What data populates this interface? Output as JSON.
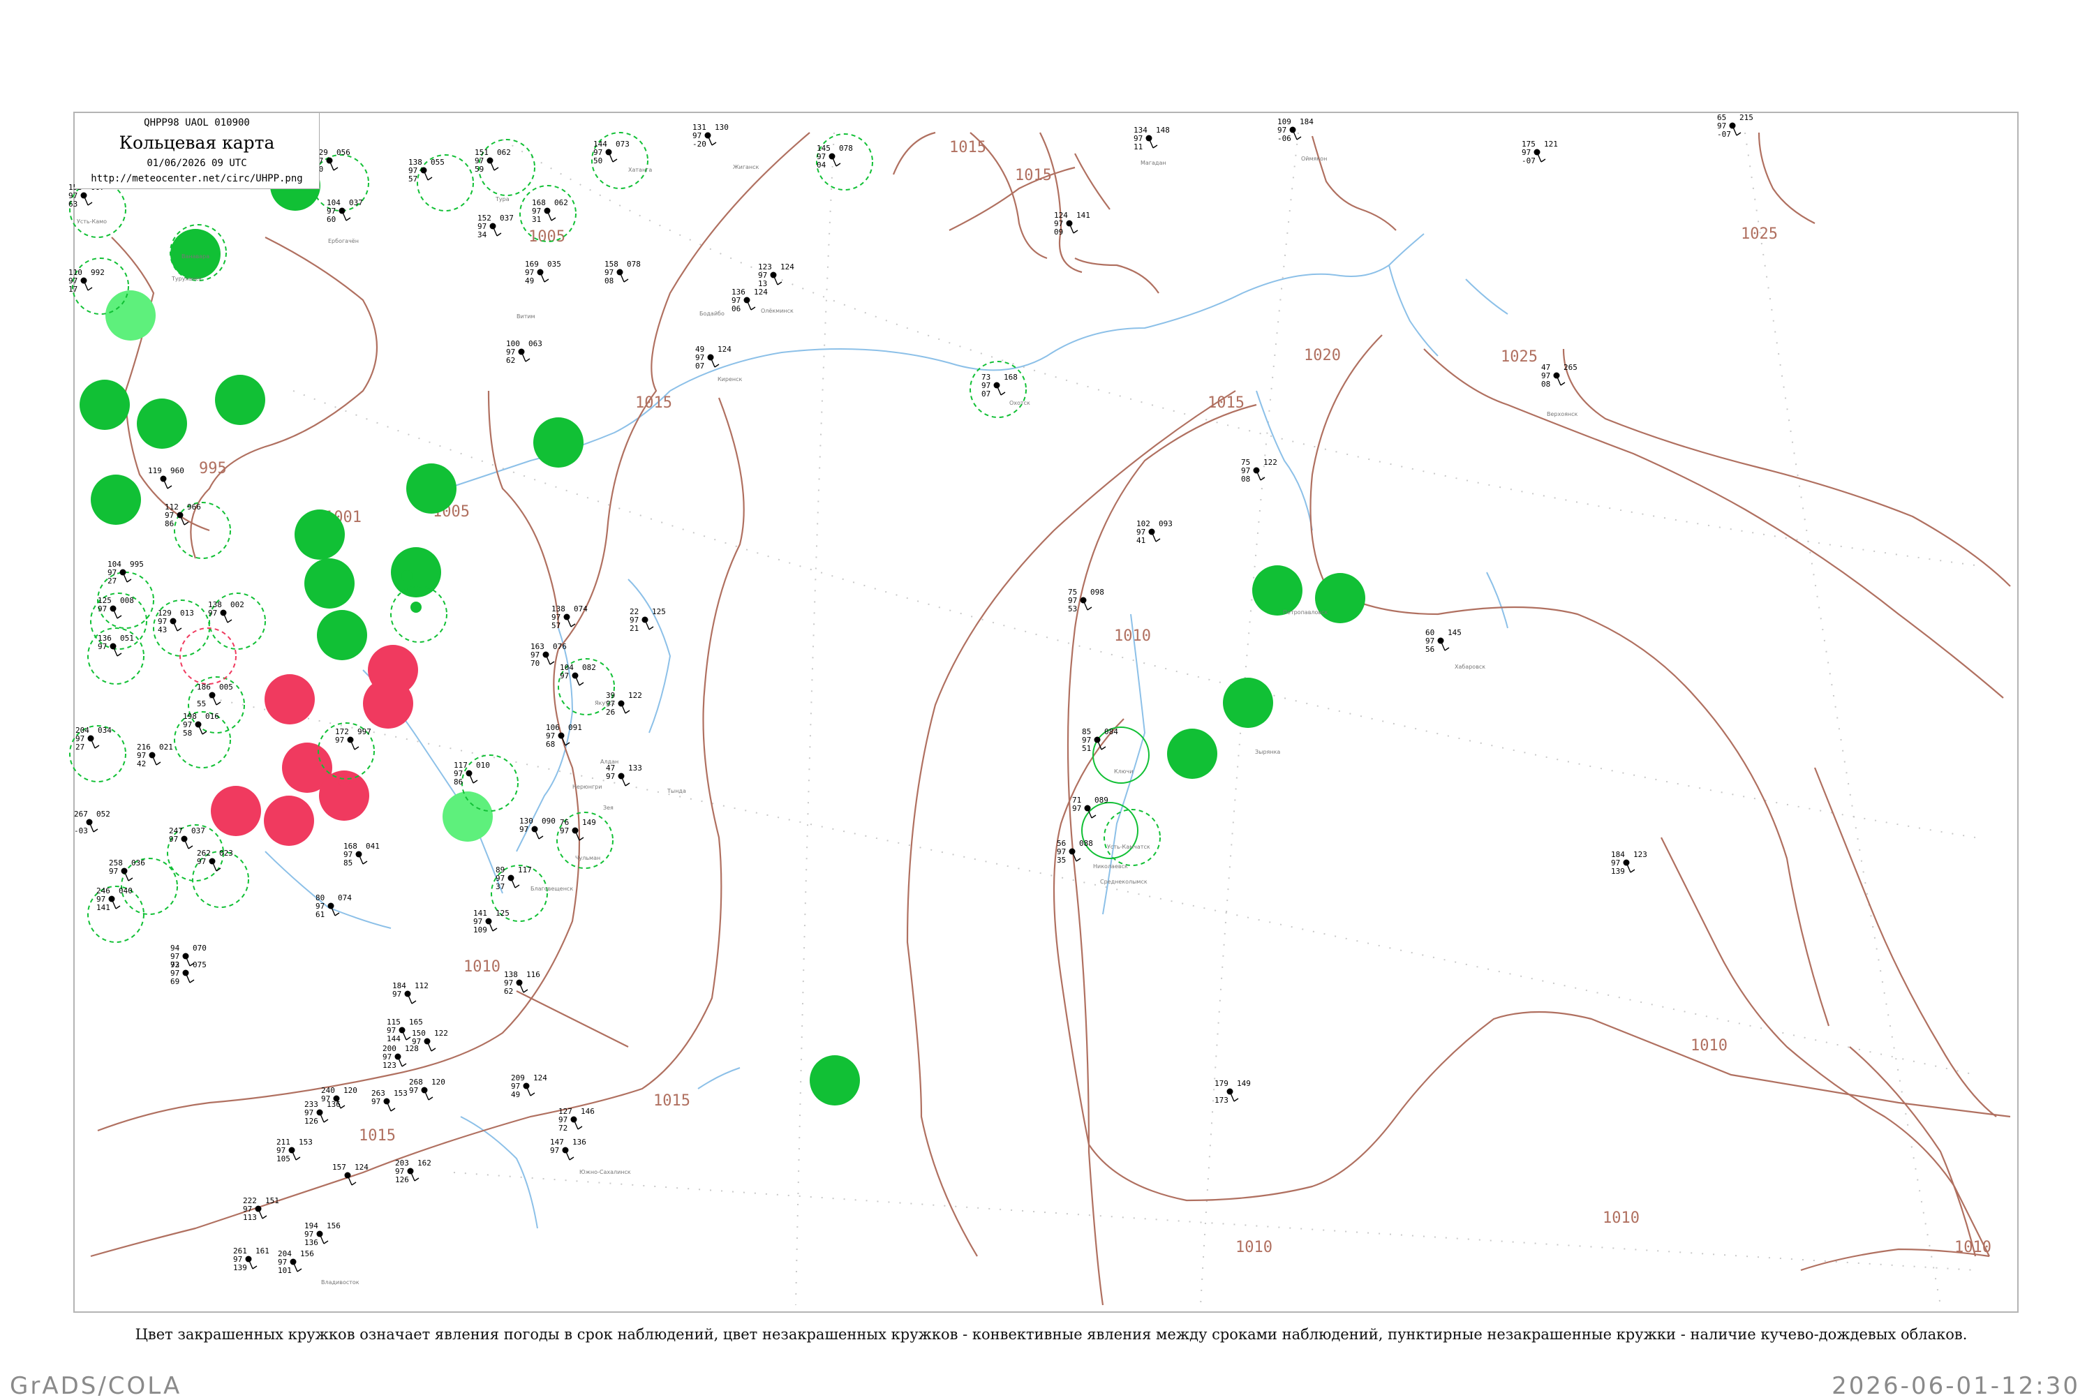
{
  "header": {
    "code": "QHPP98  UAOL  010900",
    "title": "Кольцевая карта",
    "datetime": "01/06/2026 09 UTC",
    "url": "http://meteocenter.net/circ/UHPP.png"
  },
  "caption": "Цвет закрашенных кружков означает явления погоды в срок наблюдений, цвет незакрашенных кружков - конвективные явления между сроками наблюдений, пунктирные незакрашенные кружки - наличие кучево-дождевых облаков.",
  "footer": {
    "left": "GrADS/COLA",
    "right": "2026-06-01-12:30"
  },
  "colors": {
    "isobar": "#b07060",
    "river": "#8cc0e8",
    "green": "#11c035",
    "light_green": "#5ef07c",
    "red": "#f03a5f",
    "grid": "#c8c8c8"
  },
  "isobars": [
    {
      "label": "995"
    },
    {
      "label": "1001"
    },
    {
      "label": "1005"
    },
    {
      "label": "1005"
    },
    {
      "label": "1010"
    },
    {
      "label": "1010"
    },
    {
      "label": "1010"
    },
    {
      "label": "1010"
    },
    {
      "label": "1010"
    },
    {
      "label": "1015"
    },
    {
      "label": "1015"
    },
    {
      "label": "1015"
    },
    {
      "label": "1015"
    },
    {
      "label": "1015"
    },
    {
      "label": "1015"
    },
    {
      "label": "1020"
    },
    {
      "label": "1025"
    },
    {
      "label": "1025"
    },
    {
      "label": "1010"
    }
  ],
  "stations": [
    {
      "t": "129",
      "td": "97",
      "n": "50",
      "p": "056"
    },
    {
      "t": "138",
      "td": "97",
      "n": "57",
      "p": "055"
    },
    {
      "t": "151",
      "td": "97",
      "n": "59",
      "p": "062"
    },
    {
      "t": "144",
      "td": "97",
      "n": "50",
      "p": "073"
    },
    {
      "t": "104",
      "td": "97",
      "n": "60",
      "p": "037"
    },
    {
      "t": "152",
      "td": "97",
      "n": "34",
      "p": "037"
    },
    {
      "t": "168",
      "td": "97",
      "n": "31",
      "p": "062"
    },
    {
      "t": "153",
      "td": "97",
      "n": "63",
      "p": "007"
    },
    {
      "t": "110",
      "td": "97",
      "n": "17",
      "p": "992"
    },
    {
      "t": "158",
      "td": "97",
      "n": "08",
      "p": "078"
    },
    {
      "t": "169",
      "td": "97",
      "n": "49",
      "p": "035"
    },
    {
      "t": "131",
      "td": "97",
      "n": "-20",
      "p": "130"
    },
    {
      "t": "145",
      "td": "97",
      "n": "04",
      "p": "078"
    },
    {
      "t": "134",
      "td": "97",
      "n": "11",
      "p": "148"
    },
    {
      "t": "109",
      "td": "97",
      "n": "-06",
      "p": "184"
    },
    {
      "t": "175",
      "td": "97",
      "n": "-07",
      "p": "121"
    },
    {
      "t": "65",
      "td": "97",
      "n": "-07",
      "p": "215"
    },
    {
      "t": "124",
      "td": "97",
      "n": "09",
      "p": "141"
    },
    {
      "t": "123",
      "td": "97",
      "n": "13",
      "p": "124"
    },
    {
      "t": "136",
      "td": "97",
      "n": "06",
      "p": "124"
    },
    {
      "t": "100",
      "td": "97",
      "n": "62",
      "p": "063"
    },
    {
      "t": "49",
      "td": "97",
      "n": "07",
      "p": "124"
    },
    {
      "t": "73",
      "td": "97",
      "n": "07",
      "p": "168"
    },
    {
      "t": "47",
      "td": "97",
      "n": "08",
      "p": "265"
    },
    {
      "t": "75",
      "td": "97",
      "n": "08",
      "p": "122"
    },
    {
      "t": "102",
      "td": "97",
      "n": "41",
      "p": "093"
    },
    {
      "t": "119",
      "td": "",
      "n": "",
      "p": "960"
    },
    {
      "t": "112",
      "td": "97",
      "n": "86",
      "p": "966"
    },
    {
      "t": "104",
      "td": "97",
      "n": "27",
      "p": "995"
    },
    {
      "t": "125",
      "td": "97",
      "n": "",
      "p": "008"
    },
    {
      "t": "136",
      "td": "97",
      "n": "",
      "p": "051"
    },
    {
      "t": "129",
      "td": "97",
      "n": "43",
      "p": "013"
    },
    {
      "t": "138",
      "td": "97",
      "n": "",
      "p": "002"
    },
    {
      "t": "138",
      "td": "97",
      "n": "57",
      "p": "074"
    },
    {
      "t": "22",
      "td": "97",
      "n": "21",
      "p": "125"
    },
    {
      "t": "163",
      "td": "97",
      "n": "70",
      "p": "076"
    },
    {
      "t": "104",
      "td": "97",
      "n": "",
      "p": "082"
    },
    {
      "t": "39",
      "td": "97",
      "n": "26",
      "p": "122"
    },
    {
      "t": "186",
      "td": "",
      "n": "55",
      "p": "005"
    },
    {
      "t": "198",
      "td": "97",
      "n": "58",
      "p": "016"
    },
    {
      "t": "204",
      "td": "97",
      "n": "27",
      "p": "034"
    },
    {
      "t": "216",
      "td": "97",
      "n": "42",
      "p": "021"
    },
    {
      "t": "172",
      "td": "97",
      "n": "",
      "p": "997"
    },
    {
      "t": "106",
      "td": "97",
      "n": "68",
      "p": "091"
    },
    {
      "t": "47",
      "td": "97",
      "n": "",
      "p": "133"
    },
    {
      "t": "117",
      "td": "97",
      "n": "86",
      "p": "010"
    },
    {
      "t": "267",
      "td": "",
      "n": "-03",
      "p": "052"
    },
    {
      "t": "247",
      "td": "97",
      "n": "",
      "p": "037"
    },
    {
      "t": "262",
      "td": "97",
      "n": "",
      "p": "023"
    },
    {
      "t": "258",
      "td": "97",
      "n": "",
      "p": "036"
    },
    {
      "t": "246",
      "td": "97",
      "n": "141",
      "p": "040"
    },
    {
      "t": "168",
      "td": "97",
      "n": "85",
      "p": "041"
    },
    {
      "t": "130",
      "td": "97",
      "n": "",
      "p": "090"
    },
    {
      "t": "76",
      "td": "97",
      "n": "",
      "p": "149"
    },
    {
      "t": "89",
      "td": "97",
      "n": "37",
      "p": "117"
    },
    {
      "t": "80",
      "td": "97",
      "n": "61",
      "p": "074"
    },
    {
      "t": "94",
      "td": "97",
      "n": "72",
      "p": "070"
    },
    {
      "t": "93",
      "td": "97",
      "n": "69",
      "p": "075"
    },
    {
      "t": "141",
      "td": "97",
      "n": "109",
      "p": "125"
    },
    {
      "t": "138",
      "td": "97",
      "n": "62",
      "p": "116"
    },
    {
      "t": "184",
      "td": "97",
      "n": "",
      "p": "112"
    },
    {
      "t": "115",
      "td": "97",
      "n": "144",
      "p": "165"
    },
    {
      "t": "200",
      "td": "97",
      "n": "123",
      "p": "128"
    },
    {
      "t": "209",
      "td": "97",
      "n": "49",
      "p": "124"
    },
    {
      "t": "127",
      "td": "97",
      "n": "72",
      "p": "146"
    },
    {
      "t": "147",
      "td": "97",
      "n": "",
      "p": "136"
    },
    {
      "t": "60",
      "td": "97",
      "n": "56",
      "p": "145"
    },
    {
      "t": "75",
      "td": "97",
      "n": "53",
      "p": "098"
    },
    {
      "t": "85",
      "td": "97",
      "n": "51",
      "p": "084"
    },
    {
      "t": "71",
      "td": "97",
      "n": "",
      "p": "089"
    },
    {
      "t": "56",
      "td": "97",
      "n": "35",
      "p": "088"
    },
    {
      "t": "184",
      "td": "97",
      "n": "139",
      "p": "123"
    },
    {
      "t": "179",
      "td": "",
      "n": "173",
      "p": "149"
    },
    {
      "t": "233",
      "td": "97",
      "n": "126",
      "p": "136"
    },
    {
      "t": "211",
      "td": "97",
      "n": "105",
      "p": "153"
    },
    {
      "t": "222",
      "td": "97",
      "n": "113",
      "p": "151"
    },
    {
      "t": "261",
      "td": "97",
      "n": "139",
      "p": "161"
    },
    {
      "t": "268",
      "td": "97",
      "n": "",
      "p": "120"
    },
    {
      "t": "203",
      "td": "97",
      "n": "126",
      "p": "162"
    },
    {
      "t": "194",
      "td": "97",
      "n": "136",
      "p": "156"
    },
    {
      "t": "204",
      "td": "97",
      "n": "101",
      "p": "156"
    },
    {
      "t": "157",
      "td": "",
      "n": "",
      "p": "124"
    },
    {
      "t": "240",
      "td": "97",
      "n": "",
      "p": "120"
    },
    {
      "t": "263",
      "td": "97",
      "n": "",
      "p": "153"
    },
    {
      "t": "150",
      "td": "97",
      "n": "",
      "p": "122"
    }
  ],
  "filled_stations": [
    {
      "kind": "green"
    },
    {
      "kind": "green"
    },
    {
      "kind": "light_green"
    },
    {
      "kind": "green"
    },
    {
      "kind": "green"
    },
    {
      "kind": "green"
    },
    {
      "kind": "green"
    },
    {
      "kind": "green"
    },
    {
      "kind": "green"
    },
    {
      "kind": "green"
    },
    {
      "kind": "green"
    },
    {
      "kind": "green"
    },
    {
      "kind": "green"
    },
    {
      "kind": "red"
    },
    {
      "kind": "red"
    },
    {
      "kind": "red"
    },
    {
      "kind": "red"
    },
    {
      "kind": "red"
    },
    {
      "kind": "red"
    },
    {
      "kind": "red"
    },
    {
      "kind": "light_green"
    },
    {
      "kind": "green"
    },
    {
      "kind": "green"
    },
    {
      "kind": "green"
    },
    {
      "kind": "green"
    },
    {
      "kind": "green"
    },
    {
      "kind": "green"
    },
    {
      "kind": "green"
    },
    {
      "kind": "green"
    }
  ],
  "station_names": [
    "Усть-Камо",
    "Туруханск",
    "Ванавара",
    "Ербогачён",
    "Тура",
    "Хатанга",
    "Жиганск",
    "Олёкминск",
    "Бодайбо",
    "Витим",
    "Киренск",
    "Якутск",
    "Алдан",
    "Нерюнгри",
    "Зея",
    "Тында",
    "Чульман",
    "Благовещенск",
    "Хабаровск",
    "Николаевск",
    "Охотск",
    "Магадан",
    "Оймякон",
    "Верхоянск",
    "Среднеколымск",
    "Зырянка",
    "Петропавловск",
    "Ключи",
    "Усть-Камчатск",
    "Южно-Сахалинск",
    "Владивосток"
  ]
}
